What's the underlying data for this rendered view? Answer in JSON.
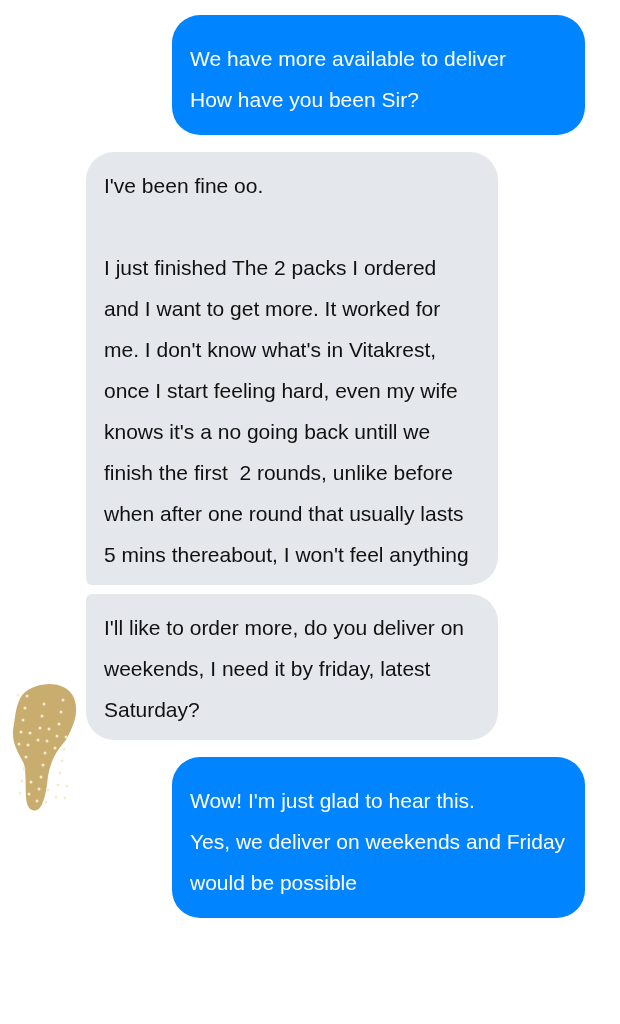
{
  "messages": [
    {
      "kind": "outgoing",
      "text": "We have more available to deliver\nHow have you been Sir?"
    },
    {
      "kind": "incoming",
      "text": "I've been fine oo.\n\nI just finished The 2 packs I ordered\nand I want to get more. It worked for me. I don't know what's in Vitakrest, once I start feeling hard, even my wife knows it's a no going back untill we finish the first  2 rounds, unlike before when after one round that usually lasts 5 mins thereabout, I won't feel anything"
    },
    {
      "kind": "incoming",
      "text": "I'll like to order more, do you deliver on weekends, I need it by friday, latest Saturday?"
    },
    {
      "kind": "outgoing",
      "text": "Wow! I'm just glad to hear this.\nYes, we deliver on weekends and Friday would be possible"
    }
  ]
}
